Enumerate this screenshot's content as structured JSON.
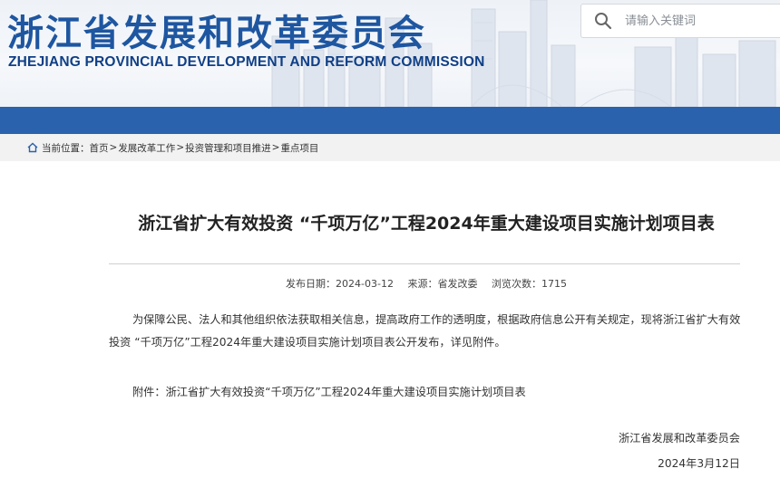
{
  "header": {
    "title": "浙江省发展和改革委员会",
    "subtitle": "ZHEJIANG PROVINCIAL DEVELOPMENT AND REFORM COMMISSION",
    "brand_color": "#1e56a0",
    "nav_color": "#2a62ad"
  },
  "search": {
    "placeholder": "请输入关键词",
    "icon": "search-icon"
  },
  "breadcrumb": {
    "prefix": "当前位置：",
    "items": [
      "首页",
      "发展改革工作",
      "投资管理和项目推进",
      "重点项目"
    ],
    "separator": ">"
  },
  "article": {
    "title": "浙江省扩大有效投资 “千项万亿”工程2024年重大建设项目实施计划项目表",
    "meta": {
      "date": "发布日期：2024-03-12",
      "source": "来源：省发改委",
      "views": "浏览次数：1715"
    },
    "body": "为保障公民、法人和其他组织依法获取相关信息，提高政府工作的透明度，根据政府信息公开有关规定，现将浙江省扩大有效投资 “千项万亿”工程2024年重大建设项目实施计划项目表公开发布，详见附件。",
    "attachment_label": "附件：",
    "attachment_name": "浙江省扩大有效投资“千项万亿”工程2024年重大建设项目实施计划项目表",
    "signature": "浙江省发展和改革委员会",
    "signature_date": "2024年3月12日"
  }
}
